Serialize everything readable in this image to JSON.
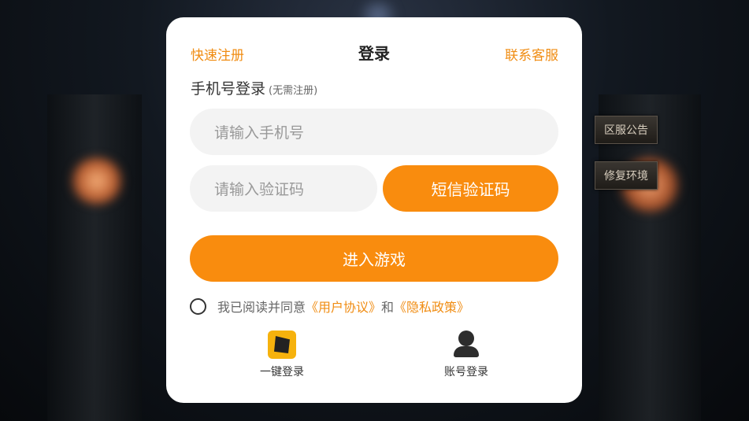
{
  "side_buttons": {
    "announcement": "区服公告",
    "repair": "修复环境"
  },
  "dialog": {
    "quick_register": "快速注册",
    "title": "登录",
    "customer_service": "联系客服",
    "section_title": "手机号登录",
    "section_note": "(无需注册)",
    "phone_placeholder": "请输入手机号",
    "code_placeholder": "请输入验证码",
    "sms_button": "短信验证码",
    "enter_button": "进入游戏",
    "agreement": {
      "prefix": "我已阅读并同意",
      "user_agreement": "《用户协议》",
      "and": "和",
      "privacy_policy": "《隐私政策》"
    },
    "alt_logins": {
      "one_click": "一键登录",
      "account": "账号登录"
    }
  },
  "colors": {
    "accent": "#f98c0e",
    "link": "#f08c12"
  },
  "icons": [
    "dragon-logo-icon",
    "person-icon"
  ]
}
